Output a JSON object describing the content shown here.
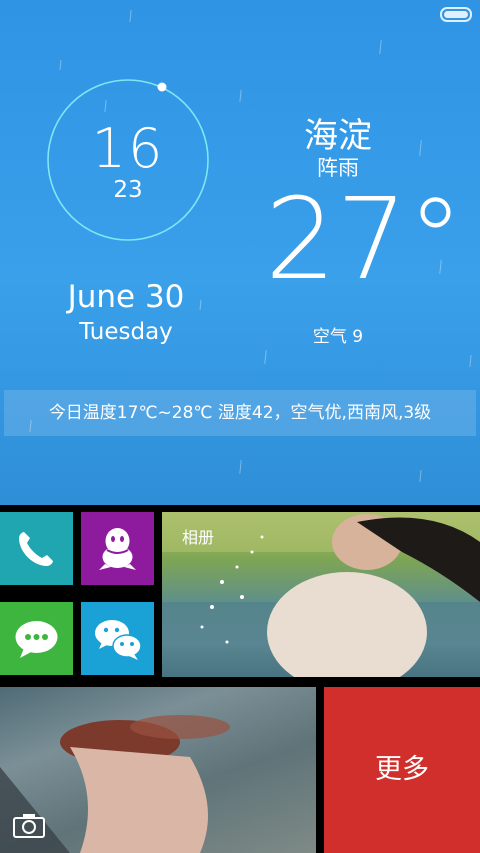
{
  "clock": {
    "hour": "16",
    "minute": "23"
  },
  "date": {
    "date_label": "June 30",
    "weekday": "Tuesday"
  },
  "weather": {
    "city": "海淀",
    "condition": "阵雨",
    "temperature": "27°",
    "air_quality": "空气 9",
    "summary": "今日温度17℃~28℃ 湿度42，空气优,西南风,3级"
  },
  "tiles": {
    "phone_icon": "phone-icon",
    "qq_icon": "qq-penguin-icon",
    "sms_icon": "message-icon",
    "wechat_icon": "wechat-icon",
    "album_label": "相册",
    "more_label": "更多",
    "camera_icon": "camera-icon"
  },
  "colors": {
    "sky": "#3aa0ea",
    "phone": "#1fa6b0",
    "qq": "#8e1b9d",
    "sms": "#3db53f",
    "wechat": "#1aa1d6",
    "more": "#d02f2c"
  }
}
